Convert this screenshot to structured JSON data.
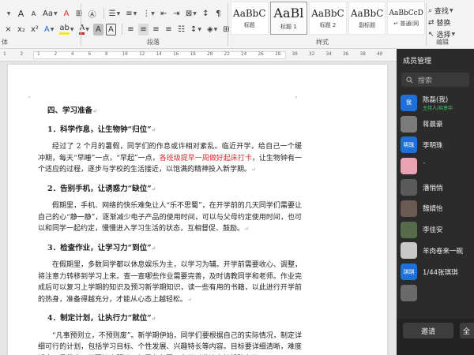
{
  "ribbon": {
    "row1": {
      "font_shrink": "A",
      "font_grow": "A",
      "aa": "Aa",
      "clear": "A"
    },
    "row2": {
      "highlight": "ab",
      "font_color": "A",
      "char_shading": "A",
      "char_border": "A"
    },
    "groups": {
      "font": "体",
      "paragraph": "段落",
      "styles": "样式",
      "editing": "编辑"
    },
    "styles": [
      {
        "preview": "AaBbC",
        "name": "标题",
        "preview_size": 12
      },
      {
        "preview": "AaBl",
        "name": "标题 1",
        "preview_size": 16,
        "active": true
      },
      {
        "preview": "AaBbC",
        "name": "标题 2",
        "preview_size": 12
      },
      {
        "preview": "AaBbC",
        "name": "副标题",
        "preview_size": 12
      },
      {
        "preview": "AaBbCcD",
        "name": "↵ 普通(网",
        "preview_size": 9
      }
    ],
    "editing": {
      "find": "查找",
      "replace": "替换",
      "select": "选择"
    }
  },
  "ruler": {
    "ticks": [
      "1",
      "2",
      "1",
      "2",
      "4",
      "6",
      "8",
      "10",
      "12",
      "14",
      "16",
      "18",
      "20",
      "22",
      "24",
      "26",
      "28",
      "30",
      "32",
      "34",
      "36",
      "38",
      "40"
    ]
  },
  "document": {
    "heading_main": "四、学习准备",
    "sections": [
      {
        "title": "1．科学作息，让生物钟“归位”",
        "para_a": "经过了 2 个月的暑假，同学们的作息或许相对紊乱。临近开学，给自己一个缓冲期，每天“早睡”一点，“早起”一点，",
        "para_red": "各班级提早一周做好起床打卡",
        "para_b": "，让生物钟有一个适应的过程，逐步与学校的生活接近，以饱满的精神投入新学期。"
      },
      {
        "title": "2．告别手机，让诱惑力“缺位”",
        "para": "假期里，手机、网络的快乐难免让人“乐不思蜀”，在开学前的几天同学们需要让自己的心“静一静”，逐渐减少电子产品的使用时间，可以与父母约定使用时间，也可以和同学一起约定，慢慢进入学习生活的状态，互相督促、鼓励。"
      },
      {
        "title": "3．检查作业，让学习力“到位”",
        "para": "在假期里，多数同学都以休息娱乐为主，以学习为辅。开学前需要收心、调整，将注意力转移到学习上来。查一查哪些作业需要完善，及时请教同学和老师。作业完成后可以复习上学期的知识及预习新学期知识，读一些有用的书籍，以此进行开学前的热身，准备得越充分，才能从心态上越轻松。"
      },
      {
        "title": "4．制定计划，让执行力“就位”",
        "para": "“凡事预则立，不预则废”。新学期伊始，同学们要根据自己的实际情况，制定详细可行的计划，包括学习目标、个性发展、兴趣特长等内容。目标要详细清晰，难度适中，易落实，不要好高骛远。如果有必要，也可以邀请家长帮助自己，"
      }
    ],
    "para_mark": "↵"
  },
  "panel": {
    "title": "成员管理",
    "search_placeholder": "搜索",
    "members": [
      {
        "name": "陈磊(我)",
        "sub": "主持人/共享中",
        "avatar_text": "我",
        "color": "#1e6fd9"
      },
      {
        "name": "蒋晨豪",
        "avatar_text": "",
        "color": "#7a7a7a"
      },
      {
        "name": "李明珠",
        "avatar_text": "明珠",
        "color": "#1e6fd9"
      },
      {
        "name": "ˋ",
        "avatar_text": "",
        "color": "#e8a3b2"
      },
      {
        "name": "潘悄悄",
        "avatar_text": "",
        "color": "#5a5a5a"
      },
      {
        "name": "魏婧怡",
        "avatar_text": "",
        "color": "#6b5a52"
      },
      {
        "name": "李佳安",
        "avatar_text": "",
        "color": "#556b4a"
      },
      {
        "name": "羊肉卷来一碗",
        "avatar_text": "",
        "color": "#c8c8c8"
      },
      {
        "name": "1/44张琪琪",
        "avatar_text": "琪琪",
        "color": "#1e6fd9"
      },
      {
        "name": "",
        "avatar_text": "",
        "color": "#6a6a6a"
      }
    ],
    "invite": "邀请",
    "invite_more": "全"
  }
}
